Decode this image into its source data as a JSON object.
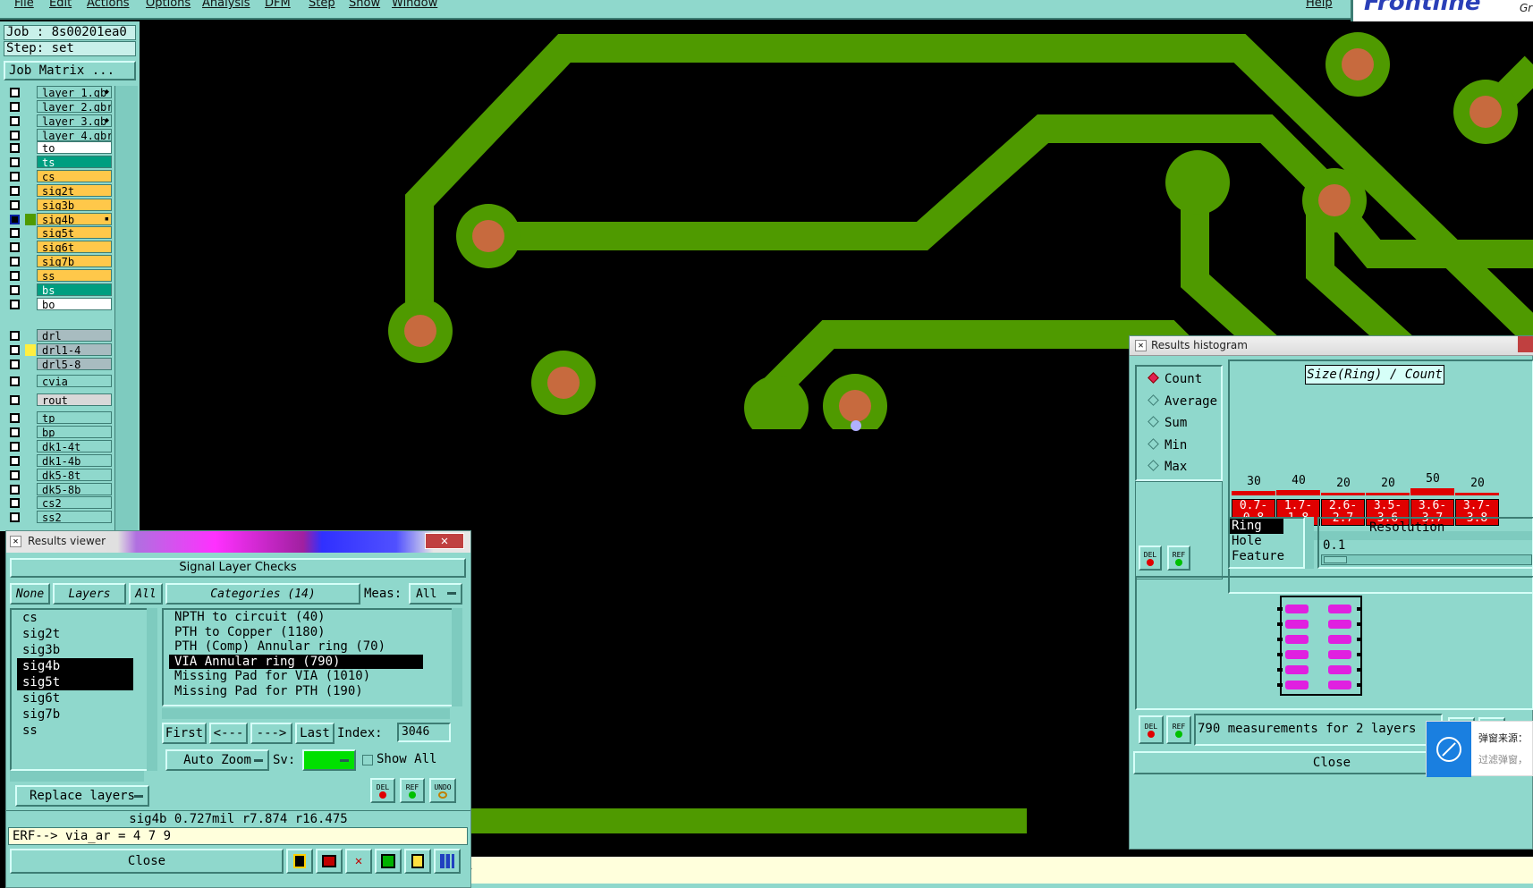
{
  "menubar": {
    "items": [
      "File",
      "Edit",
      "Actions",
      "Options",
      "Analysis",
      "DFM",
      "Step",
      "Show",
      "Window"
    ],
    "help": "Help"
  },
  "logo": {
    "text": "Frontline",
    "suffix": "Gr"
  },
  "job": {
    "job_label": "Job : 8s00201ea0",
    "step_label": "Step: set",
    "matrix_button": "Job Matrix ..."
  },
  "layers": [
    {
      "name": "layer_1.gb",
      "color": "#8fd8cc",
      "marker": "◆"
    },
    {
      "name": "layer_2.gbr",
      "color": "#8fd8cc",
      "marker": ""
    },
    {
      "name": "layer_3.gb",
      "color": "#8fd8cc",
      "marker": "◆"
    },
    {
      "name": "layer_4.gbr",
      "color": "#8fd8cc",
      "marker": ""
    },
    {
      "name": "to",
      "color": "#ffffff",
      "marker": ""
    },
    {
      "name": "ts",
      "color": "#009e80",
      "marker": ""
    },
    {
      "name": "cs",
      "color": "#ffc84a",
      "marker": ""
    },
    {
      "name": "sig2t",
      "color": "#ffc84a",
      "marker": ""
    },
    {
      "name": "sig3b",
      "color": "#ffc84a",
      "marker": ""
    },
    {
      "name": "sig4b",
      "color": "#ffc84a",
      "marker": "▪"
    },
    {
      "name": "sig5t",
      "color": "#ffc84a",
      "marker": ""
    },
    {
      "name": "sig6t",
      "color": "#ffc84a",
      "marker": ""
    },
    {
      "name": "sig7b",
      "color": "#ffc84a",
      "marker": ""
    },
    {
      "name": "ss",
      "color": "#ffc84a",
      "marker": ""
    },
    {
      "name": "bs",
      "color": "#009e80",
      "marker": ""
    },
    {
      "name": "bo",
      "color": "#ffffff",
      "marker": ""
    },
    {
      "name": "drl",
      "color": "#a8bcc0",
      "marker": ""
    },
    {
      "name": "drl1-4",
      "color": "#a8bcc0",
      "marker": ""
    },
    {
      "name": "drl5-8",
      "color": "#a8bcc0",
      "marker": ""
    },
    {
      "name": "cvia",
      "color": "#8fd8cc",
      "marker": ""
    },
    {
      "name": "rout",
      "color": "#d8d8d8",
      "marker": ""
    },
    {
      "name": "tp",
      "color": "#8fd8cc",
      "marker": ""
    },
    {
      "name": "bp",
      "color": "#8fd8cc",
      "marker": ""
    },
    {
      "name": "dk1-4t",
      "color": "#8fd8cc",
      "marker": ""
    },
    {
      "name": "dk1-4b",
      "color": "#8fd8cc",
      "marker": ""
    },
    {
      "name": "dk5-8t",
      "color": "#8fd8cc",
      "marker": ""
    },
    {
      "name": "dk5-8b",
      "color": "#8fd8cc",
      "marker": ""
    },
    {
      "name": "cs2",
      "color": "#8fd8cc",
      "marker": ""
    },
    {
      "name": "ss2",
      "color": "#8fd8cc",
      "marker": ""
    }
  ],
  "results_viewer": {
    "title": "Results viewer",
    "heading": "Signal Layer Checks",
    "none_button": "None",
    "layers_button": "Layers",
    "all_button": "All",
    "categories_button": "Categories (14)",
    "meas_label": "Meas:",
    "meas_value": "All",
    "layer_list": [
      "cs",
      "sig2t",
      "sig3b",
      "sig4b",
      "sig5t",
      "sig6t",
      "sig7b",
      "ss"
    ],
    "category_list": [
      "NPTH to circuit (40)",
      "PTH to Copper (1180)",
      "PTH (Comp) Annular ring (70)",
      "VIA Annular ring (790)",
      "Missing Pad for VIA (1010)",
      "Missing Pad for PTH (190)"
    ],
    "first_button": "First",
    "prev_button": "<---",
    "next_button": "--->",
    "last_button": "Last",
    "index_label": "Index:",
    "index_value": "3046",
    "auto_zoom": "Auto Zoom",
    "sv_label": "Sv:",
    "show_all": "Show All",
    "replace_layers": "Replace layers",
    "del_label": "DEL",
    "ref_label": "REF",
    "undo_label": "UNDO",
    "status": "sig4b 0.727mil  r7.874  r16.475",
    "erf_line": "ERF--> via_ar = 4 7 9",
    "close_button": "Close"
  },
  "histogram": {
    "title": "Results histogram",
    "modes": [
      "Count",
      "Average",
      "Sum",
      "Min",
      "Max"
    ],
    "chart_title": "Size(Ring) / Count",
    "del_label": "DEL",
    "ref_label": "REF",
    "type_list": [
      "Ring",
      "Hole",
      "Feature"
    ],
    "resolution_label": "Resolution",
    "resolution_value": "0.1",
    "summary": "790 measurements for 2 layers",
    "close_button": "Close"
  },
  "chart_data": {
    "type": "bar",
    "title": "Size(Ring) / Count",
    "categories": [
      "0.7-0.8",
      "1.7-1.8",
      "2.6-2.7",
      "3.5-3.6",
      "3.6-3.7",
      "3.7-3.8"
    ],
    "values": [
      30,
      40,
      20,
      20,
      50,
      20
    ],
    "value_labels": [
      "30",
      "40",
      "20",
      "20",
      "50",
      "20"
    ],
    "category_line1": [
      "0.7-",
      "1.7-",
      "2.6-",
      "3.5-",
      "3.6-",
      "3.7-"
    ],
    "category_line2": [
      "0.8",
      "1.8",
      "2.7",
      "3.6",
      "3.7",
      "3.8"
    ]
  },
  "popup": {
    "line1": "弹窗来源：",
    "line2": "过滤弹窗，"
  },
  "colors": {
    "panel": "#8fd8cc",
    "copper": "#4f9a00",
    "pad": "#c76a3e",
    "bar": "#e00000",
    "selection": "#000000"
  }
}
